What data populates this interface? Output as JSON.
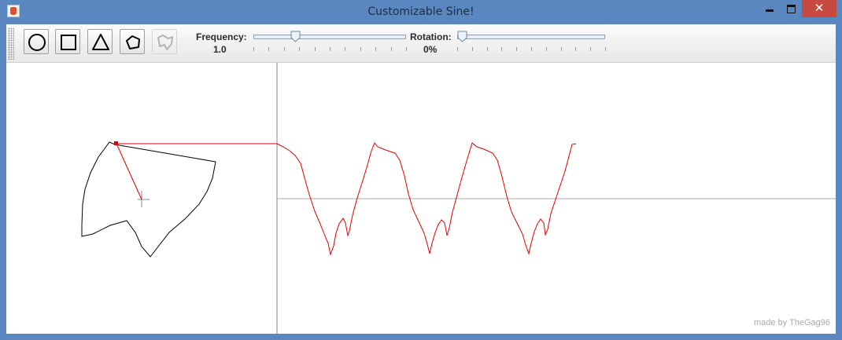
{
  "window": {
    "title": "Customizable Sine!",
    "close_glyph": "✕"
  },
  "toolbar": {
    "shapes": [
      {
        "name": "circle-shape-button",
        "icon": "circle-icon",
        "enabled": true
      },
      {
        "name": "square-shape-button",
        "icon": "square-icon",
        "enabled": true
      },
      {
        "name": "triangle-shape-button",
        "icon": "triangle-icon",
        "enabled": true
      },
      {
        "name": "pentagon-shape-button",
        "icon": "pentagon-icon",
        "enabled": true
      },
      {
        "name": "custom-shape-button",
        "icon": "freeform-shape-icon",
        "enabled": false
      }
    ],
    "frequency": {
      "label": "Frequency:",
      "value_text": "1.0",
      "position_fraction": 0.26
    },
    "rotation": {
      "label": "Rotation:",
      "value_text": "0%",
      "position_fraction": 0.0
    }
  },
  "canvas": {
    "credit": "made by TheGag96",
    "colors": {
      "shape": "#000000",
      "trace": "#e00000",
      "axis": "#8a8a8a"
    }
  }
}
